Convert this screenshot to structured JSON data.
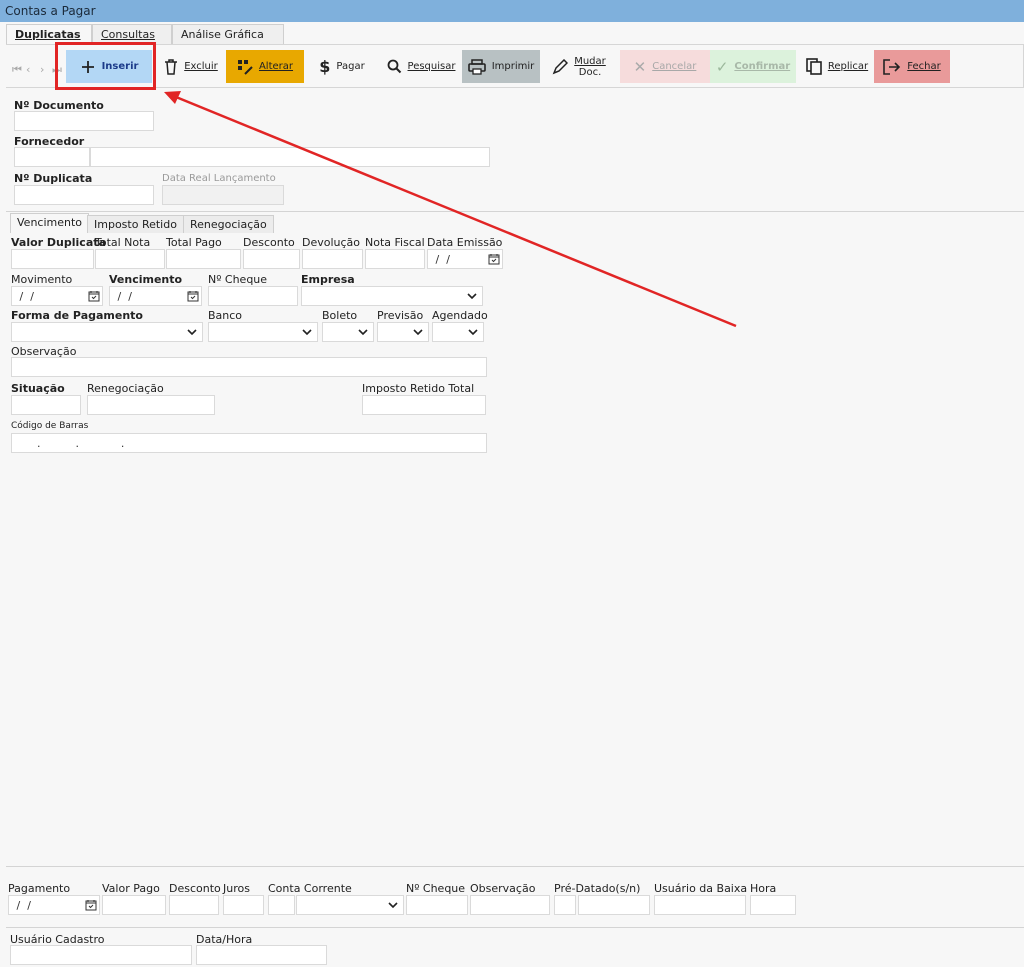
{
  "window": {
    "title": "Contas a Pagar"
  },
  "main_tabs": [
    "Duplicatas",
    "Consultas",
    "Análise Gráfica"
  ],
  "nav_icons": [
    "first-icon",
    "prev-icon",
    "next-icon",
    "last-icon"
  ],
  "toolbar": {
    "inserir": "Inserir",
    "excluir": "Excluir",
    "alterar": "Alterar",
    "pagar": "Pagar",
    "pesquisar": "Pesquisar",
    "imprimir": "Imprimir",
    "mudar_line1": "Mudar",
    "mudar_line2": "Doc.",
    "cancelar": "Cancelar",
    "confirmar": "Confirmar",
    "replicar": "Replicar",
    "fechar": "Fechar"
  },
  "header": {
    "documento": "Nº Documento",
    "fornecedor": "Fornecedor",
    "duplicata": "Nº Duplicata",
    "data_real": "Data Real Lançamento"
  },
  "inner_tabs": [
    "Vencimento",
    "Imposto Retido",
    "Renegociação"
  ],
  "venc": {
    "valor_duplicata": "Valor Duplicata",
    "total_nota": "Total Nota",
    "total_pago": "Total  Pago",
    "desconto": "Desconto",
    "devolucao": "Devolução",
    "nota_fiscal": "Nota Fiscal",
    "data_emissao": "Data Emissão",
    "movimento": "Movimento",
    "vencimento": "Vencimento",
    "cheque": "Nº Cheque",
    "empresa": "Empresa",
    "forma_pagamento": "Forma de Pagamento",
    "banco": "Banco",
    "boleto": "Boleto",
    "previsao": "Previsão",
    "agendado": "Agendado",
    "observacao": "Observação",
    "situacao": "Situação",
    "renegociacao": "Renegociação",
    "imposto_total": "Imposto Retido Total",
    "codigo_barras": "Código de Barras",
    "date_mask": " /  /",
    "barcode_mask": "      .          .            ."
  },
  "pagamento": {
    "pagamento": "Pagamento",
    "valor_pago": "Valor Pago",
    "desconto": "Desconto",
    "juros": "Juros",
    "conta_corrente": "Conta Corrente",
    "cheque": "Nº Cheque",
    "observacao": "Observação",
    "pre_datado": "Pré-Datado(s/n)",
    "usuario_baixa": "Usuário da Baixa",
    "hora": "Hora"
  },
  "footer": {
    "usuario_cadastro": "Usuário Cadastro",
    "data_hora": "Data/Hora"
  },
  "colors": {
    "titlebar": "#7fb0dc",
    "inserir_bg": "#b3d7f5",
    "alterar_bg": "#e8a800",
    "imprimir_bg": "#b8c1c3",
    "cancelar_bg": "#f6dcdc",
    "confirmar_bg": "#dcf2dc",
    "fechar_bg": "#e99a9a",
    "annotation": "#e12525"
  }
}
